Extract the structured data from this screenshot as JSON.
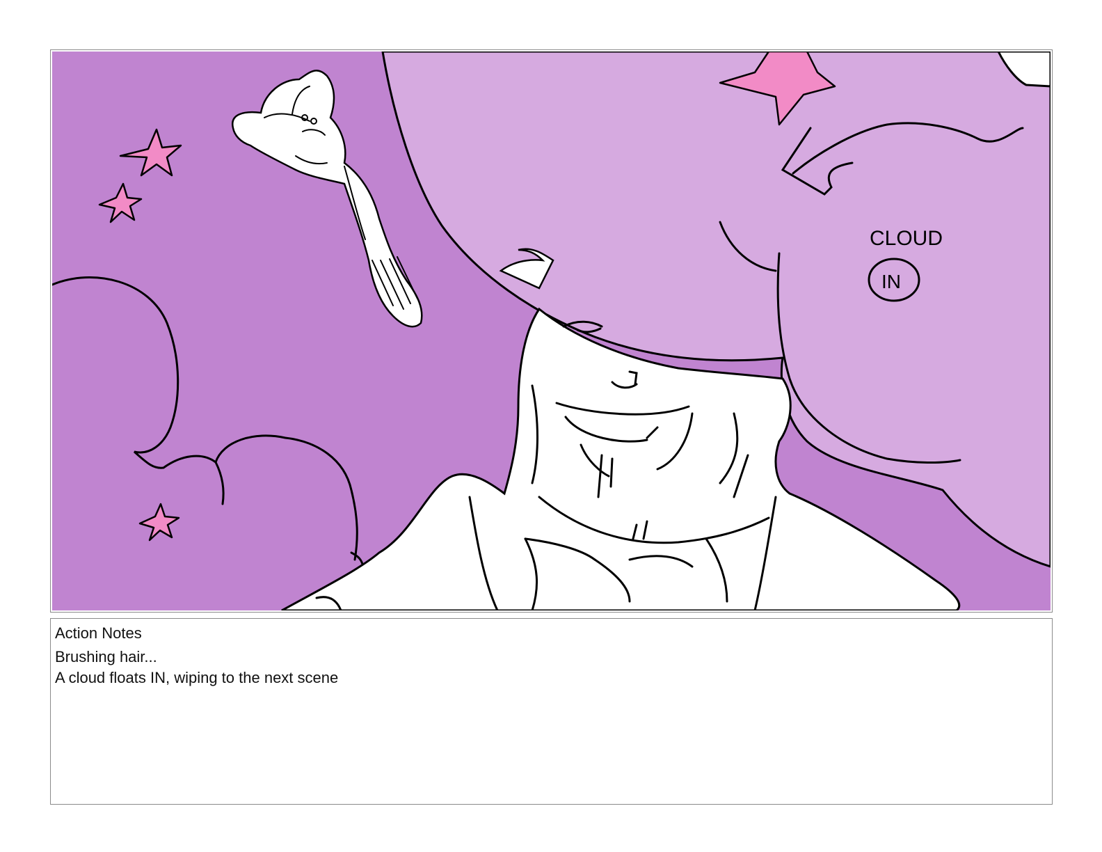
{
  "panel": {
    "colors": {
      "background": "#c084d0",
      "cloud_fill": "#d6aae0",
      "star_fill": "#f28bc6",
      "ink": "#000000",
      "highlight": "#ffffff"
    },
    "sketch_note_line1": "CLOUD",
    "sketch_note_line2": "IN"
  },
  "notes": {
    "heading": "Action Notes",
    "lines": [
      "Brushing hair...",
      "A cloud floats IN, wiping to the next scene"
    ]
  }
}
